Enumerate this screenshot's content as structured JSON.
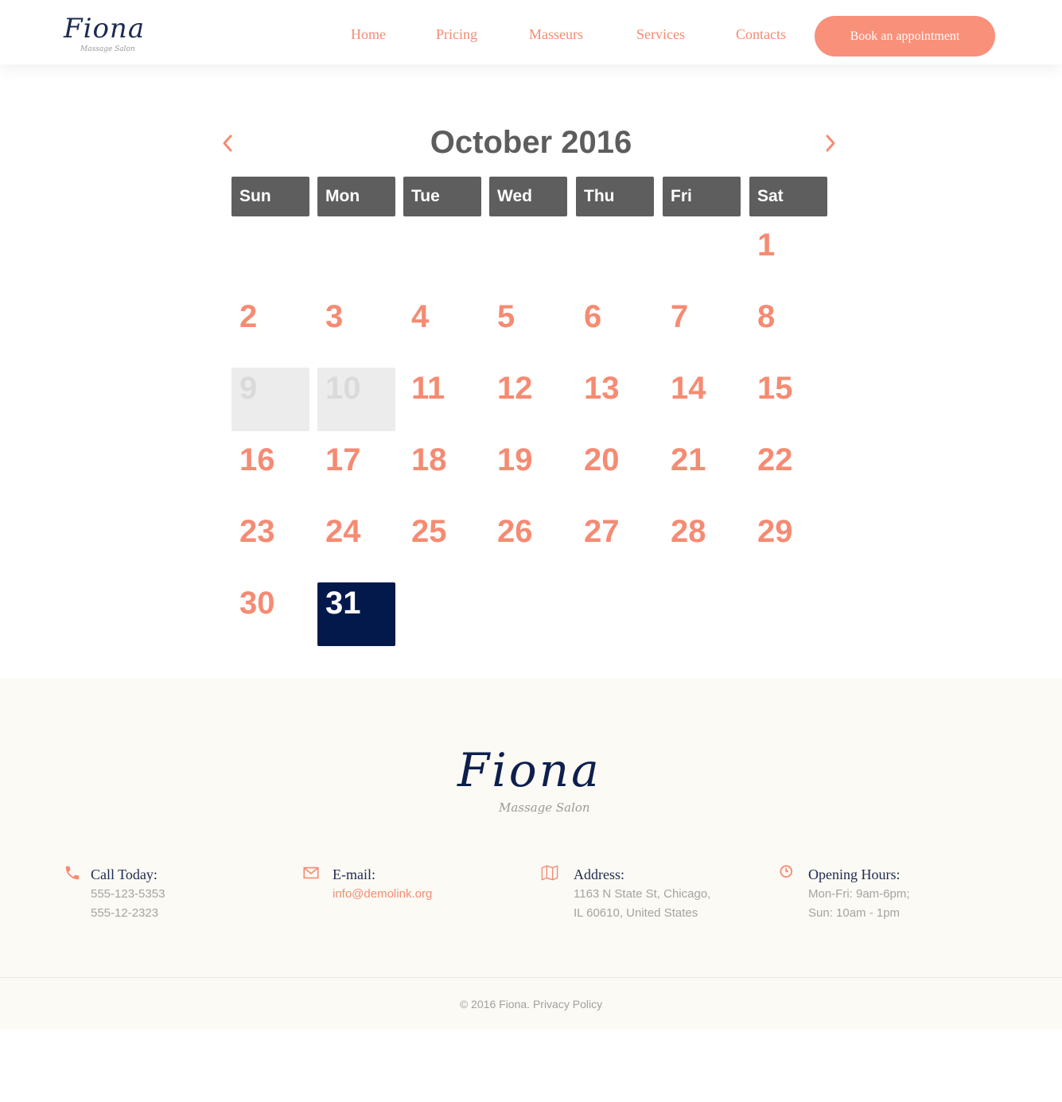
{
  "brand": {
    "logo_script": "Fiona",
    "logo_sub": "Massage Salon"
  },
  "nav": {
    "items": [
      "Home",
      "Pricing",
      "Masseurs",
      "Services",
      "Contacts"
    ],
    "cta": "Book an appointment"
  },
  "calendar": {
    "month_title": "October 2016",
    "weekdays": [
      "Sun",
      "Mon",
      "Tue",
      "Wed",
      "Thu",
      "Fri",
      "Sat"
    ],
    "days": [
      "1",
      "2",
      "3",
      "4",
      "5",
      "6",
      "7",
      "8",
      "9",
      "10",
      "11",
      "12",
      "13",
      "14",
      "15",
      "16",
      "17",
      "18",
      "19",
      "20",
      "21",
      "22",
      "23",
      "24",
      "25",
      "26",
      "27",
      "28",
      "29",
      "30",
      "31"
    ],
    "disabled_days": [
      "9",
      "10"
    ],
    "selected_day": "31",
    "prev_icon": "chevron-left-icon",
    "next_icon": "chevron-right-icon"
  },
  "footer": {
    "logo_script": "Fiona",
    "logo_sub": "Massage Salon",
    "call": {
      "label": "Call Today:",
      "lines": [
        "555-123-5353",
        "555-12-2323"
      ],
      "icon": "phone-icon"
    },
    "email": {
      "label": "E-mail:",
      "value": "info@demolink.org",
      "icon": "envelope-icon"
    },
    "address": {
      "label": "Address:",
      "lines": [
        "1163 N State St, Chicago,",
        "IL 60610, United States"
      ],
      "icon": "map-icon"
    },
    "hours": {
      "label": "Opening Hours:",
      "lines": [
        "Mon-Fri: 9am-6pm;",
        "Sun: 10am - 1pm"
      ],
      "icon": "clock-icon"
    },
    "copyright": "© 2016 Fiona. Privacy Policy"
  },
  "colors": {
    "accent": "#f58b73",
    "navy": "#04194b",
    "header_cell": "#5e5e5e",
    "disabled_cell": "#ececec",
    "footer_bg": "#fbfaf4"
  }
}
